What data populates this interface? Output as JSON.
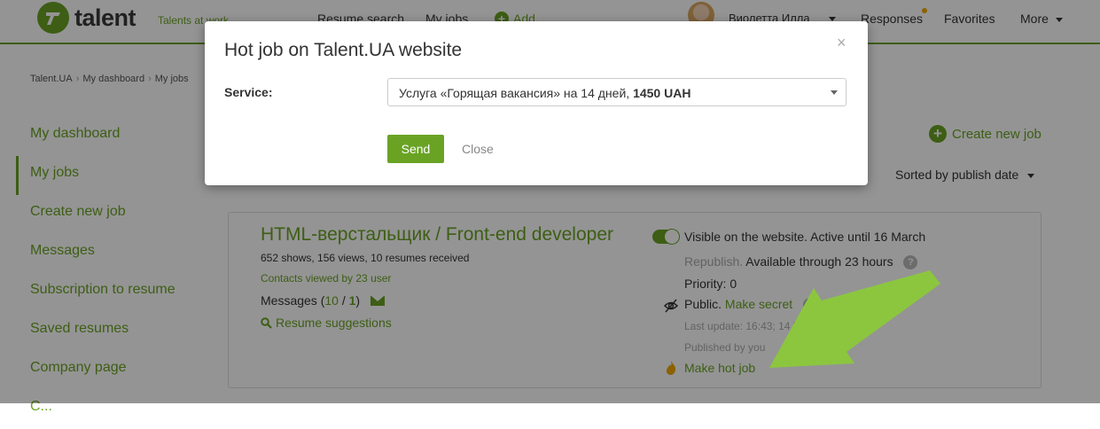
{
  "header": {
    "logo_text": "talent",
    "tagline": "Talents at work",
    "nav": {
      "resume_search": "Resume search",
      "my_jobs": "My jobs",
      "add": "Add",
      "user_name": "Виолетта Илла",
      "responses": "Responses",
      "favorites": "Favorites",
      "more": "More"
    }
  },
  "breadcrumb": [
    "Talent.UA",
    "My dashboard",
    "My jobs"
  ],
  "sidebar": {
    "items": [
      {
        "label": "My dashboard"
      },
      {
        "label": "My jobs"
      },
      {
        "label": "Create new job"
      },
      {
        "label": "Messages"
      },
      {
        "label": "Subscription to resume"
      },
      {
        "label": "Saved resumes"
      },
      {
        "label": "Company page"
      },
      {
        "label": "C..."
      }
    ]
  },
  "actions": {
    "create_new_job": "Create new job",
    "sorted_by": "Sorted by publish date"
  },
  "job": {
    "title": "HTML-верстальщик / Front-end developer",
    "stats": "652 shows, 156 views, 10 resumes received",
    "contacts": "Contacts viewed by 23 user",
    "messages_label": "Messages (",
    "messages_count": "10",
    "messages_sep": " / ",
    "messages_new": "1",
    "messages_close": ")",
    "resume_suggestions": "Resume suggestions",
    "visible": "Visible on the website. Active until 16 March",
    "republish": "Republish.",
    "available": "Available through 23 hours",
    "priority": "Priority: 0",
    "public": "Public.",
    "make_secret": "Make secret",
    "last_update": "Last update: 16:43; 14 F...",
    "published_by": "Published by you",
    "make_hot": "Make hot job"
  },
  "modal": {
    "title": "Hot job on Talent.UA website",
    "close_x": "×",
    "service_label": "Service:",
    "service_value": "Услуга «Горящая вакансия» на 14 дней,",
    "service_price": "1450 UAH",
    "send": "Send",
    "close": "Close"
  },
  "colors": {
    "brand_green": "#6aa324",
    "arrow_green": "#8cc63f",
    "badge_orange": "#f2a900"
  }
}
